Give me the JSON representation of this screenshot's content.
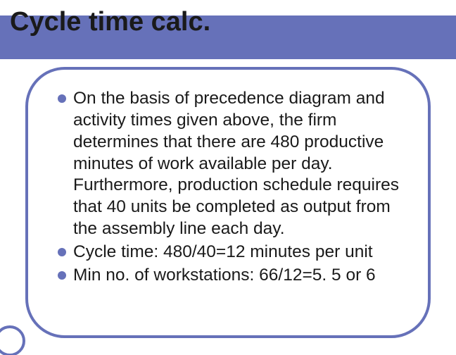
{
  "slide": {
    "title": "Cycle time calc.",
    "colors": {
      "accent": "#6671b9"
    },
    "bullets": [
      {
        "text": "On the basis of precedence diagram and activity times given above, the firm determines that there are 480 productive minutes of work available per day. Furthermore, production schedule requires that 40 units be completed as output from the assembly line each day."
      },
      {
        "text": "Cycle time: 480/40=12 minutes per unit"
      },
      {
        "text": "Min no. of workstations: 66/12=5. 5 or 6"
      }
    ]
  }
}
